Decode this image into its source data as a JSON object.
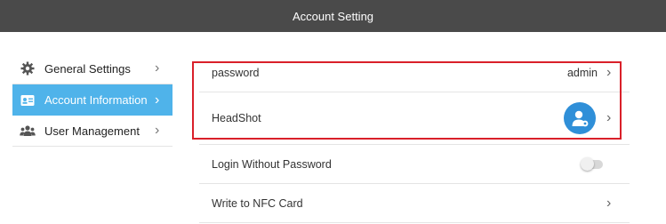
{
  "window": {
    "title": "Account Setting"
  },
  "sidebar": {
    "items": [
      {
        "label": "General Settings",
        "icon": "gear-icon",
        "active": false
      },
      {
        "label": "Account Information",
        "icon": "id-card-icon",
        "active": true
      },
      {
        "label": "User Management",
        "icon": "users-icon",
        "active": false
      }
    ]
  },
  "settings": {
    "password": {
      "label": "password",
      "value": "admin"
    },
    "headshot": {
      "label": "HeadShot"
    },
    "login_without_password": {
      "label": "Login Without Password",
      "enabled": false
    },
    "nfc": {
      "label": "Write to NFC Card"
    }
  },
  "colors": {
    "title_bar": "#4a4a4a",
    "active_item": "#4fb3ea",
    "highlight": "#d9202a",
    "avatar": "#2f8fd8"
  }
}
